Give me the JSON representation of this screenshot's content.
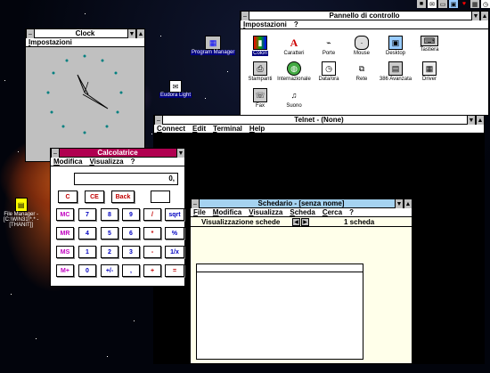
{
  "clock": {
    "title": "Clock",
    "menu": [
      "Impostazioni"
    ]
  },
  "desktop_icons": {
    "program_manager": "Program Manager",
    "eudora": "Eudora Light",
    "file_manager_1": "File Manager -",
    "file_manager_2": "[C:\\WIN31\\*.* -",
    "file_manager_3": "[THANIT]]"
  },
  "control_panel": {
    "title": "Pannello di controllo",
    "menu": [
      "Impostazioni",
      "?"
    ],
    "items": [
      "Colori",
      "Caratteri",
      "Porte",
      "Mouse",
      "Desktop",
      "Tastiera",
      "Stampanti",
      "Internazionale",
      "Data/ora",
      "Rete",
      "386 Avanzata",
      "Driver",
      "Fax",
      "Suono"
    ]
  },
  "telnet": {
    "title": "Telnet - (None)",
    "menu": [
      "Connect",
      "Edit",
      "Terminal",
      "Help"
    ]
  },
  "calculator": {
    "title": "Calcolatrice",
    "menu": [
      "Modifica",
      "Visualizza",
      "?"
    ],
    "display": "0,",
    "buttons": {
      "c": "C",
      "ce": "CE",
      "back": "Back",
      "mc": "MC",
      "mr": "MR",
      "ms": "MS",
      "mplus": "M+",
      "n7": "7",
      "n8": "8",
      "n9": "9",
      "div": "/",
      "sqrt": "sqrt",
      "n4": "4",
      "n5": "5",
      "n6": "6",
      "mul": "*",
      "pct": "%",
      "n1": "1",
      "n2": "2",
      "n3": "3",
      "sub": "-",
      "inv": "1/x",
      "n0": "0",
      "sign": "+/-",
      "dec": ",",
      "add": "+",
      "eq": "="
    }
  },
  "cardfile": {
    "title": "Schedario - [senza nome]",
    "menu": [
      "File",
      "Modifica",
      "Visualizza",
      "Scheda",
      "Cerca",
      "?"
    ],
    "view_label": "Visualizzazione schede",
    "count": "1 scheda"
  },
  "tray_icons": [
    "windows-icon",
    "mail-icon",
    "monitor-icon",
    "display-icon",
    "heart-icon",
    "grid-icon",
    "clock-icon"
  ],
  "colors": {
    "titlebar_active": "#a5d2f0",
    "calc_titlebar": "#b00050",
    "desktop": "#02040c"
  }
}
